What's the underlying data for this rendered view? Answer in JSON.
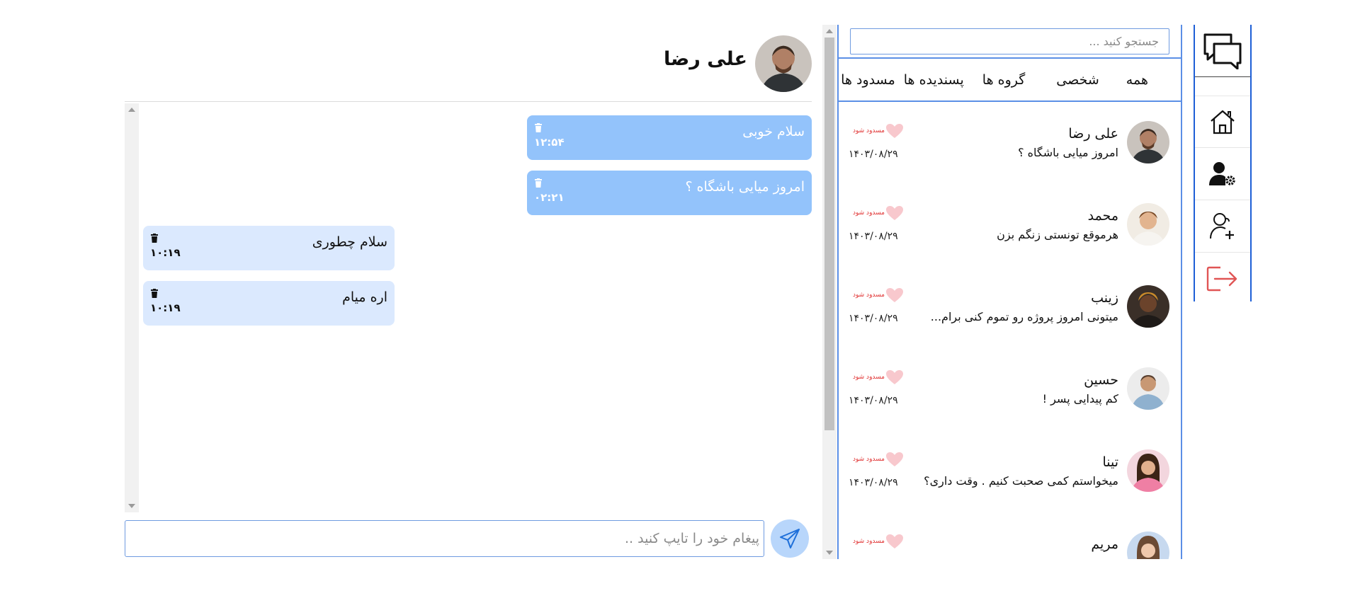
{
  "sidebar": {
    "items": [
      {
        "icon": "chat-bubbles-icon"
      },
      {
        "icon": "home-icon"
      },
      {
        "icon": "user-settings-icon"
      },
      {
        "icon": "add-user-icon"
      },
      {
        "icon": "logout-icon"
      }
    ]
  },
  "search": {
    "placeholder": "جستجو کنید ..."
  },
  "tabs": [
    "همه",
    "شخصی",
    "گروه ها",
    "پسندیده ها",
    "مسدود ها"
  ],
  "contacts": [
    {
      "name": "علی رضا",
      "last_message": "امروز میایی باشگاه ؟",
      "date": "۱۴۰۳/۰۸/۲۹",
      "block_label": "مسدود شود"
    },
    {
      "name": "محمد",
      "last_message": "هرموقع تونستی زنگم بزن",
      "date": "۱۴۰۳/۰۸/۲۹",
      "block_label": "مسدود شود"
    },
    {
      "name": "زینب",
      "last_message": "میتونی امروز پروژه رو تموم کنی برام...",
      "date": "۱۴۰۳/۰۸/۲۹",
      "block_label": "مسدود شود"
    },
    {
      "name": "حسین",
      "last_message": "کم پیدایی پسر !",
      "date": "۱۴۰۳/۰۸/۲۹",
      "block_label": "مسدود شود"
    },
    {
      "name": "تینا",
      "last_message": "میخواستم کمی صحبت کنیم . وقت داری؟",
      "date": "۱۴۰۳/۰۸/۲۹",
      "block_label": "مسدود شود"
    },
    {
      "name": "مریم",
      "last_message": "",
      "date": "",
      "block_label": "مسدود شود"
    }
  ],
  "chat": {
    "contact_name": "علی رضا",
    "messages": [
      {
        "direction": "out",
        "text": "سلام خوبی",
        "time": "۱۲:۵۴"
      },
      {
        "direction": "out",
        "text": "امروز میایی باشگاه ؟",
        "time": "۰۲:۲۱"
      },
      {
        "direction": "in",
        "text": "سلام چطوری",
        "time": "۱۰:۱۹"
      },
      {
        "direction": "in",
        "text": "اره میام",
        "time": "۱۰:۱۹"
      }
    ],
    "composer_placeholder": "پیغام خود را تایپ کنید .."
  },
  "colors": {
    "accent_border": "#5b8fe6",
    "outgoing_bubble": "#93c3fb",
    "incoming_bubble": "#dbe9fe",
    "block_text": "#e03030",
    "heart": "#f8c8cd",
    "logout": "#e05555"
  }
}
